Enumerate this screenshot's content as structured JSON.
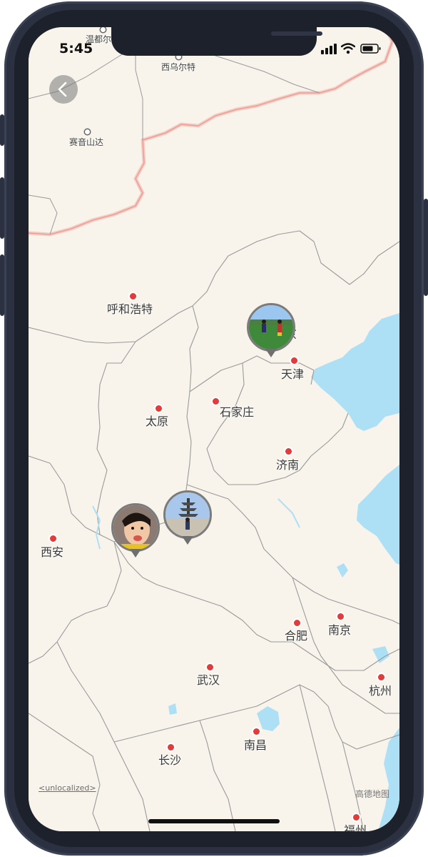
{
  "status_bar": {
    "time": "5:45"
  },
  "map": {
    "cities": [
      {
        "name": "温都尔汗",
        "size": "small"
      },
      {
        "name": "西乌尔特",
        "size": "small"
      },
      {
        "name": "赛音山达",
        "size": "small"
      },
      {
        "name": "呼和浩特",
        "size": "large"
      },
      {
        "name": "北京",
        "size": "large"
      },
      {
        "name": "天津",
        "size": "large"
      },
      {
        "name": "太原",
        "size": "large"
      },
      {
        "name": "石家庄",
        "size": "large"
      },
      {
        "name": "济南",
        "size": "large"
      },
      {
        "name": "西安",
        "size": "large"
      },
      {
        "name": "合肥",
        "size": "large"
      },
      {
        "name": "南京",
        "size": "large"
      },
      {
        "name": "武汉",
        "size": "large"
      },
      {
        "name": "杭州",
        "size": "large"
      },
      {
        "name": "南昌",
        "size": "large"
      },
      {
        "name": "长沙",
        "size": "large"
      },
      {
        "name": "福州",
        "size": "large"
      }
    ],
    "photo_pins": [
      {
        "subject": "two kids playing football on a field"
      },
      {
        "subject": "child in front of a pagoda"
      },
      {
        "subject": "portrait of a girl"
      }
    ],
    "water_color": "#aee0f5",
    "land_color": "#f8f4ec",
    "border_color": "#9a9a9a",
    "country_border_color": "#f2b5ad"
  },
  "footer": {
    "unlocalized_label": "<unlocalized>",
    "attribution": "高德地图"
  },
  "icons": {
    "back": "chevron-left-icon",
    "signal": "cellular-signal-icon",
    "wifi": "wifi-icon",
    "battery": "battery-icon"
  }
}
